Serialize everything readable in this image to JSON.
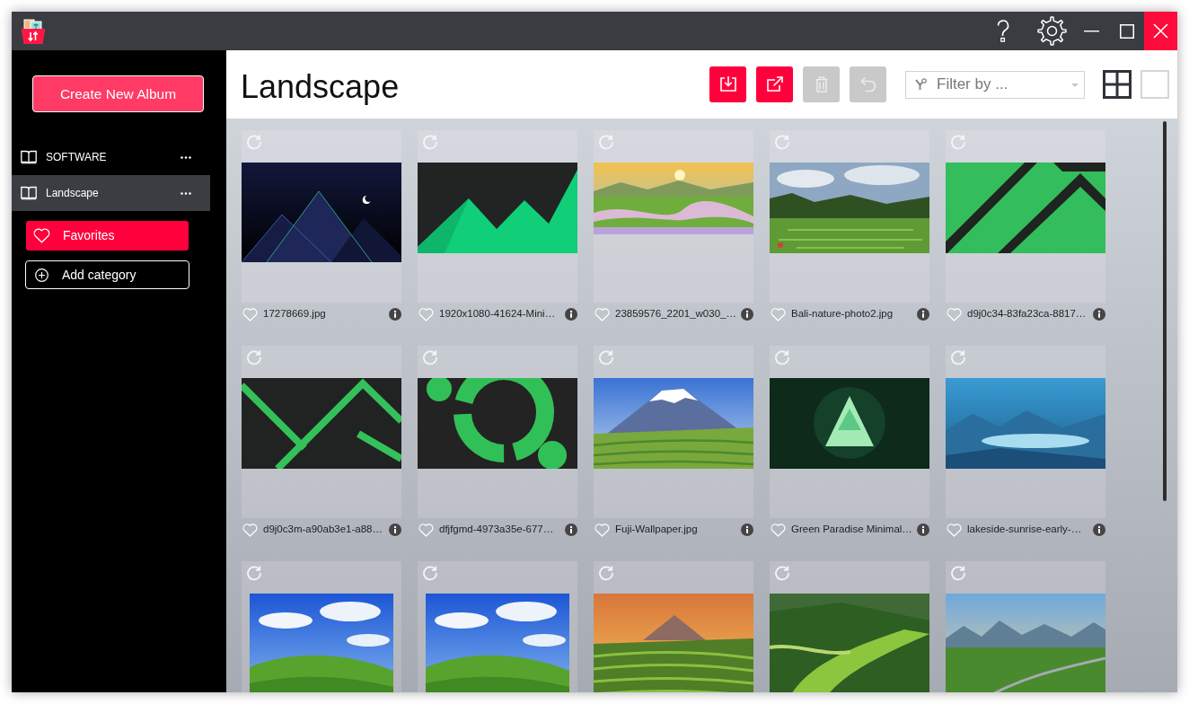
{
  "sidebar": {
    "create_button": "Create New Album",
    "albums": [
      {
        "label": "SOFTWARE",
        "selected": false
      },
      {
        "label": "Landscape",
        "selected": true
      }
    ],
    "category_buttons": [
      {
        "kind": "favorites",
        "label": "Favorites"
      },
      {
        "kind": "add",
        "label": "Add category"
      }
    ]
  },
  "header": {
    "title": "Landscape",
    "toolbar": [
      {
        "kind": "import",
        "disabled": false
      },
      {
        "kind": "export",
        "disabled": false
      },
      {
        "kind": "delete",
        "disabled": true
      },
      {
        "kind": "undo",
        "disabled": true
      }
    ],
    "filter": {
      "placeholder": "Filter by ..."
    },
    "view_modes": [
      {
        "kind": "grid",
        "selected": true
      },
      {
        "kind": "single",
        "selected": false
      }
    ]
  },
  "gallery": {
    "items": [
      {
        "kind": "pyramids",
        "name": "17278669.jpg",
        "favorite": false
      },
      {
        "kind": "peaks",
        "name": "1920x1080-41624-Mini…",
        "favorite": false
      },
      {
        "kind": "terraces",
        "name": "23859576_2201_w030_…",
        "favorite": false
      },
      {
        "kind": "rainforest",
        "name": "Bali-nature-photo2.jpg",
        "favorite": false
      },
      {
        "kind": "stripes",
        "name": "d9j0c34-83fa23ca-8817…",
        "favorite": false
      },
      {
        "kind": "lines",
        "name": "d9j0c3m-a90ab3e1-a88…",
        "favorite": false
      },
      {
        "kind": "ring",
        "name": "dfjfgmd-4973a35e-677…",
        "favorite": false
      },
      {
        "kind": "volcano",
        "name": "Fuji-Wallpaper.jpg",
        "favorite": false
      },
      {
        "kind": "emblem",
        "name": "Green Paradise Minimal…",
        "favorite": false
      },
      {
        "kind": "lake",
        "name": "lakeside-sunrise-early-…",
        "favorite": false
      },
      {
        "kind": "meadow"
      },
      {
        "kind": "meadow"
      },
      {
        "kind": "sunset"
      },
      {
        "kind": "valley"
      },
      {
        "kind": "river"
      }
    ]
  }
}
